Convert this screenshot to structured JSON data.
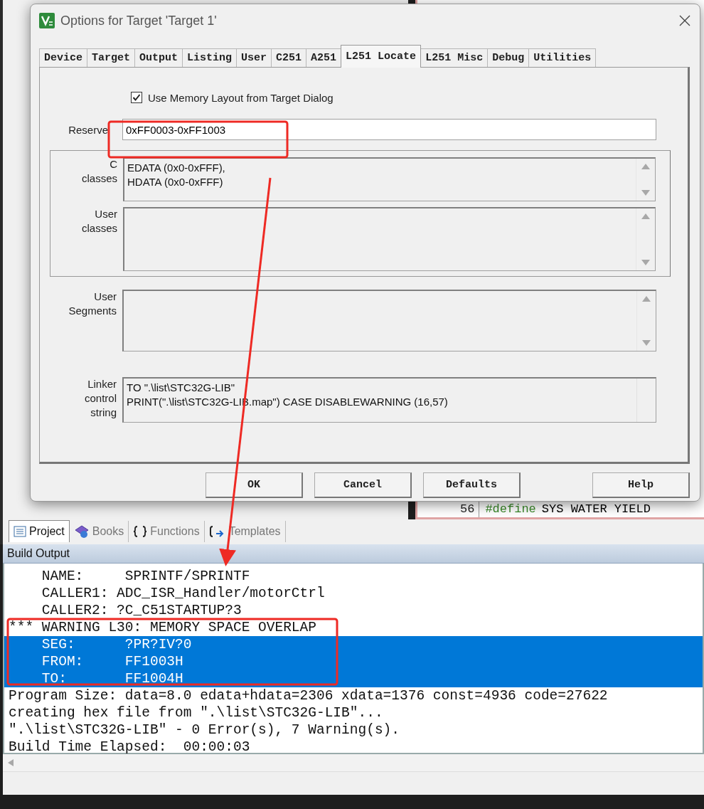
{
  "dialog": {
    "title": "Options for Target 'Target 1'",
    "tabs": [
      {
        "label": "Device",
        "selected": false
      },
      {
        "label": "Target",
        "selected": false
      },
      {
        "label": "Output",
        "selected": false
      },
      {
        "label": "Listing",
        "selected": false
      },
      {
        "label": "User",
        "selected": false
      },
      {
        "label": "C251",
        "selected": false
      },
      {
        "label": "A251",
        "selected": false
      },
      {
        "label": "L251 Locate",
        "selected": true
      },
      {
        "label": "L251 Misc",
        "selected": false
      },
      {
        "label": "Debug",
        "selected": false
      },
      {
        "label": "Utilities",
        "selected": false
      }
    ],
    "use_memory_layout": {
      "label": "Use Memory Layout from Target Dialog",
      "checked": true
    },
    "reserve": {
      "label": "Reserve",
      "value": "0xFF0003-0xFF1003"
    },
    "class_group": [
      {
        "label": "C classes",
        "kind": "scroll",
        "lines": [
          "EDATA (0x0-0xFFF),",
          "HDATA (0x0-0xFFF)"
        ]
      },
      {
        "label": "User classes",
        "kind": "scroll"
      }
    ],
    "user_segments": {
      "label": "User Segments",
      "kind": "scroll"
    },
    "linker": {
      "label": "Linker control string",
      "kind": "plain",
      "lines": [
        "TO \".\\list\\STC32G-LIB\"",
        "PRINT(\".\\list\\STC32G-LIB.map\") CASE DISABLEWARNING (16,57)"
      ]
    },
    "buttons": [
      "OK",
      "Cancel",
      "Defaults",
      "Help"
    ]
  },
  "editor": {
    "lines": [
      {
        "number": "56",
        "directive": "#define",
        "text": "SYS WATER YIELD"
      }
    ]
  },
  "panel_tabs": [
    {
      "label": "Project",
      "selected": true
    },
    {
      "label": "Books",
      "selected": false
    },
    {
      "label": "Functions",
      "selected": false
    },
    {
      "label": "Templates",
      "selected": false
    }
  ],
  "build_output": {
    "title": "Build Output",
    "lines": [
      {
        "text": "    NAME:     SPRINTF/SPRINTF",
        "selected": false
      },
      {
        "text": "    CALLER1: ADC_ISR_Handler/motorCtrl",
        "selected": false
      },
      {
        "text": "    CALLER2: ?C_C51STARTUP?3",
        "selected": false
      },
      {
        "text": "*** WARNING L30: MEMORY SPACE OVERLAP",
        "selected": false
      },
      {
        "text": "    SEG:      ?PR?IV?0",
        "selected": true
      },
      {
        "text": "    FROM:     FF1003H",
        "selected": true
      },
      {
        "text": "    TO:       FF1004H",
        "selected": true
      },
      {
        "text": "Program Size: data=8.0 edata+hdata=2306 xdata=1376 const=4936 code=27622",
        "selected": false
      },
      {
        "text": "creating hex file from \".\\list\\STC32G-LIB\"...",
        "selected": false
      },
      {
        "text": "\".\\list\\STC32G-LIB\" - 0 Error(s), 7 Warning(s).",
        "selected": false
      },
      {
        "text": "Build Time Elapsed:  00:00:03",
        "selected": false
      }
    ]
  }
}
